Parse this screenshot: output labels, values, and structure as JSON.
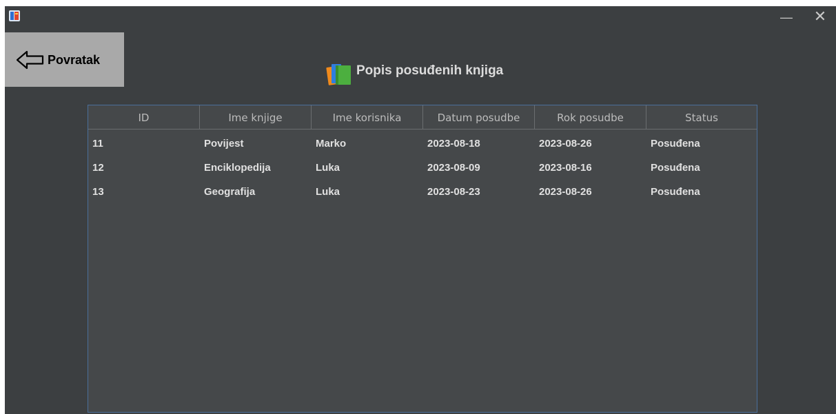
{
  "window": {
    "controls": {
      "minimize": "—",
      "close": "✕"
    }
  },
  "back_button": {
    "label": "Povratak",
    "icon": "arrow-left-outline-icon"
  },
  "page": {
    "title": "Popis posuđenih knjiga",
    "title_icon": "books-icon"
  },
  "table": {
    "columns": [
      "ID",
      "Ime knjige",
      "Ime korisnika",
      "Datum posudbe",
      "Rok posudbe",
      "Status"
    ],
    "rows": [
      [
        "11",
        "Povijest",
        "Marko",
        "2023-08-18",
        "2023-08-26",
        "Posuđena"
      ],
      [
        "12",
        "Enciklopedija",
        "Luka",
        "2023-08-09",
        "2023-08-16",
        "Posuđena"
      ],
      [
        "13",
        "Geografija",
        "Luka",
        "2023-08-23",
        "2023-08-26",
        "Posuđena"
      ]
    ]
  },
  "colors": {
    "background": "#3c3f41",
    "panel": "#45484a",
    "border": "#4a6f9b",
    "back_button": "#a9a9a9"
  }
}
